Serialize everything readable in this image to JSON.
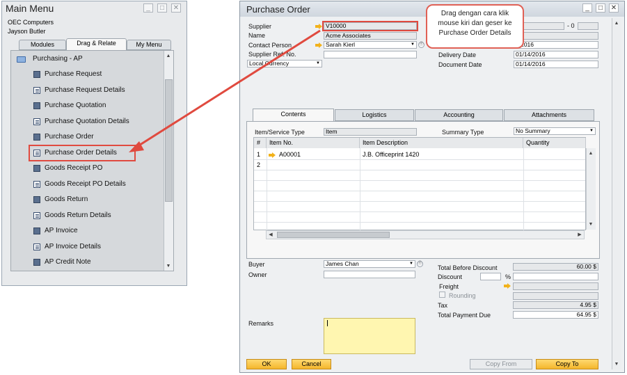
{
  "main_menu": {
    "title": "Main Menu",
    "company": "OEC Computers",
    "user": "Jayson Butler",
    "tabs": [
      "Modules",
      "Drag & Relate",
      "My Menu"
    ],
    "group": "Purchasing - AP",
    "items": [
      "Purchase Request",
      "Purchase Request Details",
      "Purchase Quotation",
      "Purchase Quotation Details",
      "Purchase Order",
      "Purchase Order Details",
      "Goods Receipt PO",
      "Goods Receipt PO Details",
      "Goods Return",
      "Goods Return Details",
      "AP Invoice",
      "AP Invoice Details",
      "AP Credit Note"
    ]
  },
  "po": {
    "title": "Purchase Order",
    "supplier_label": "Supplier",
    "supplier_value": "V10000",
    "name_label": "Name",
    "name_value": "Acme Associates",
    "contact_label": "Contact Person",
    "contact_value": "Sarah Kierl",
    "ref_label": "Supplier Ref. No.",
    "currency_value": "Local Currency",
    "series_suffix": "- 0",
    "status_partial": "n",
    "posting_partial": "4/2016",
    "delivery_label": "Delivery Date",
    "delivery_value": "01/14/2016",
    "document_label": "Document Date",
    "document_value": "01/14/2016",
    "tabs": [
      "Contents",
      "Logistics",
      "Accounting",
      "Attachments"
    ],
    "item_type_label": "Item/Service Type",
    "item_type_value": "Item",
    "summary_type_label": "Summary Type",
    "summary_type_value": "No Summary",
    "grid_headers": [
      "#",
      "Item No.",
      "Item Description",
      "Quantity"
    ],
    "rows": [
      {
        "num": "1",
        "item_no": "A00001",
        "desc": "J.B. Officeprint 1420"
      },
      {
        "num": "2",
        "item_no": "",
        "desc": ""
      }
    ],
    "buyer_label": "Buyer",
    "buyer_value": "James Chan",
    "owner_label": "Owner",
    "remarks_label": "Remarks",
    "tbd_label": "Total Before Discount",
    "tbd_value": "60.00 $",
    "discount_label": "Discount",
    "percent": "%",
    "freight_label": "Freight",
    "rounding_label": "Rounding",
    "tax_label": "Tax",
    "tax_value": "4.95 $",
    "total_label": "Total Payment Due",
    "total_value": "64.95 $",
    "ok_label": "OK",
    "cancel_label": "Cancel",
    "copy_from_label": "Copy From",
    "copy_to_label": "Copy To"
  },
  "callout": {
    "text_line1": "Drag dengan cara klik",
    "text_line2": "mouse kiri dan geser ke",
    "text_line3": "Purchase Order Details"
  },
  "colors": {
    "highlight": "#e04a3f",
    "accent": "#f4b62c"
  }
}
